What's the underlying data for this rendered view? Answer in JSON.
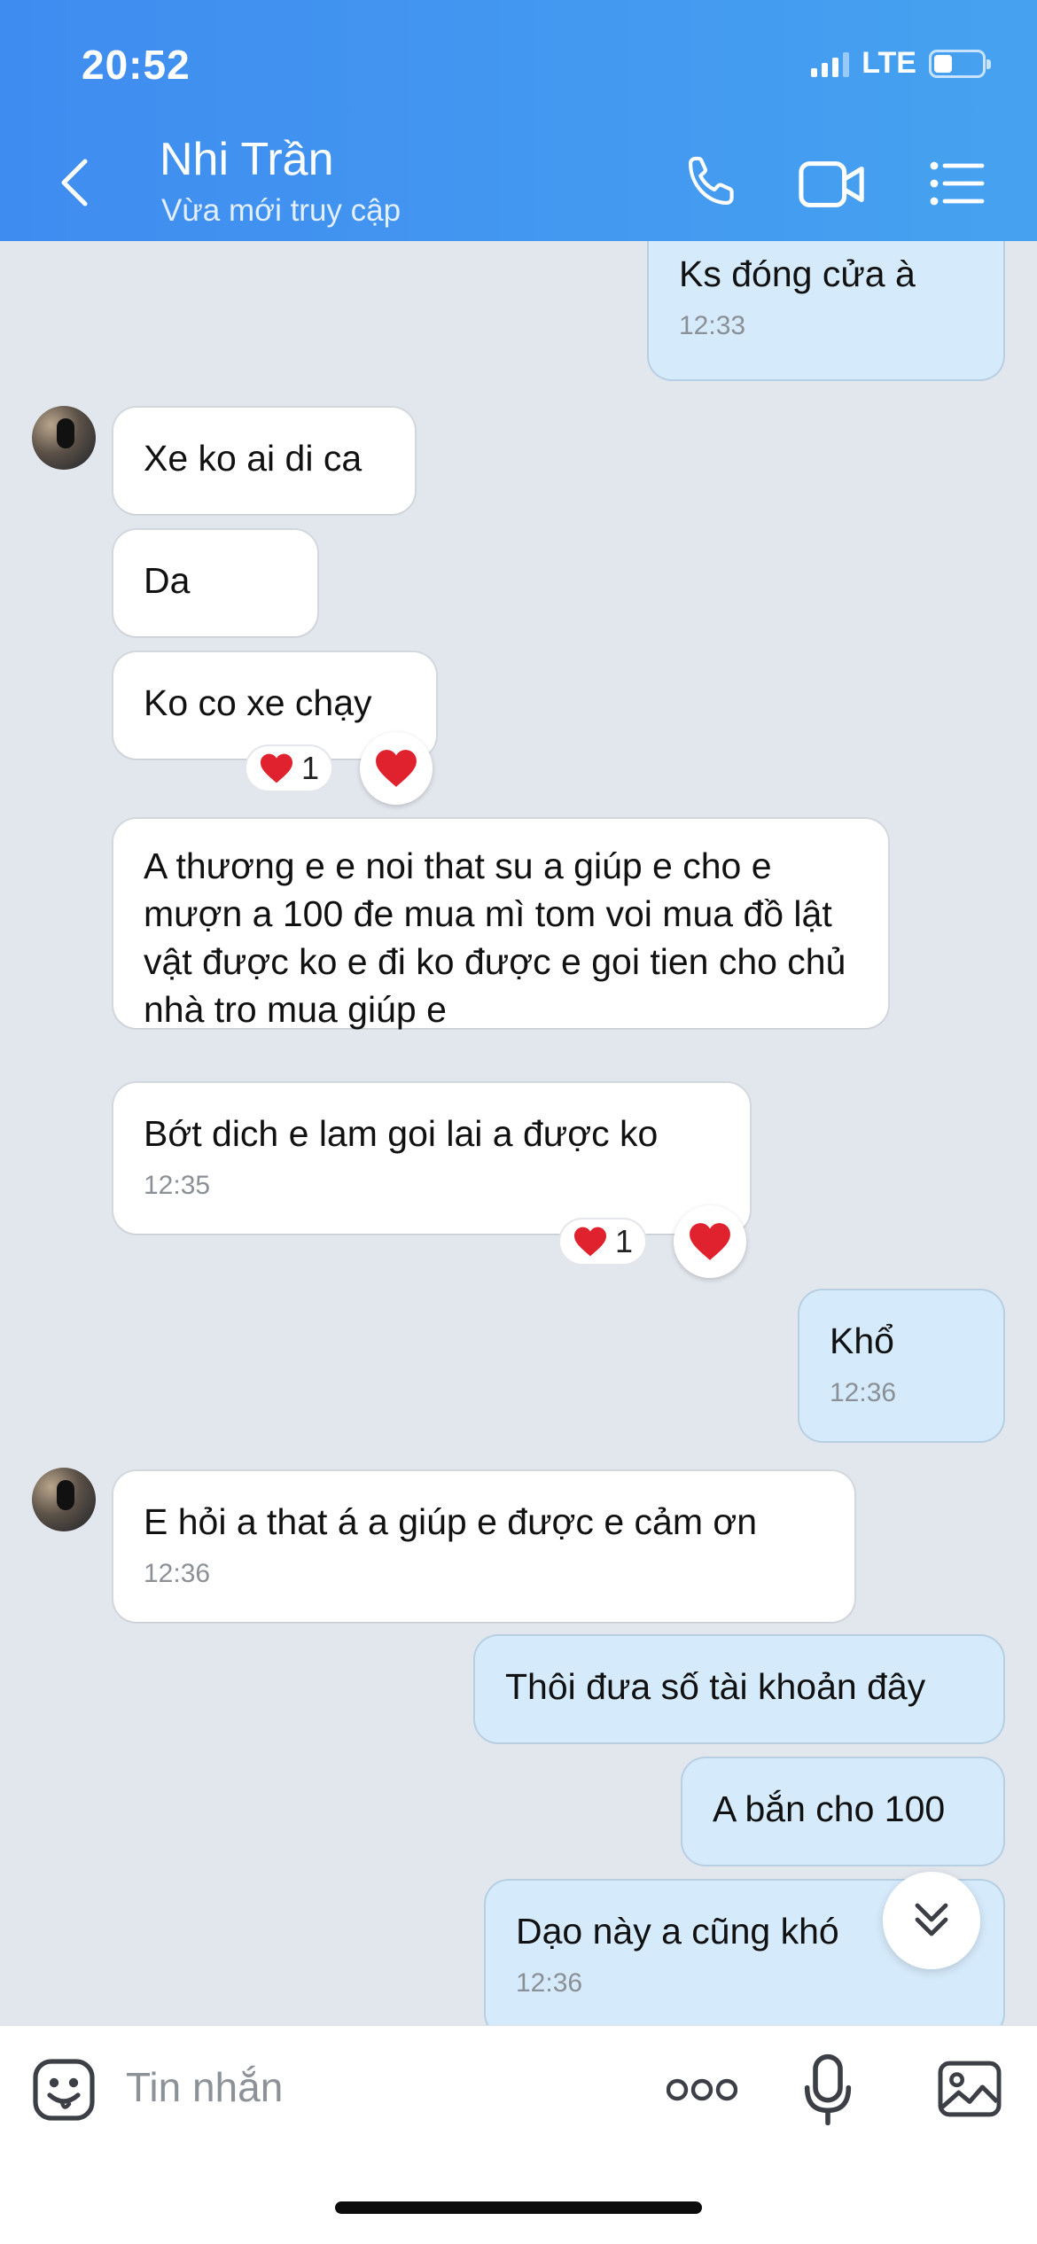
{
  "status_bar": {
    "time": "20:52",
    "network": "LTE"
  },
  "header": {
    "contact_name": "Nhi Trần",
    "contact_status": "Vừa mới truy cập",
    "icons": [
      "back-arrow-icon",
      "phone-icon",
      "video-call-icon",
      "menu-list-icon"
    ]
  },
  "messages": [
    {
      "dir": "out",
      "text": "Ks đóng cửa à",
      "time": "12:33"
    },
    {
      "dir": "in",
      "text": "Xe ko ai di ca"
    },
    {
      "dir": "in",
      "text": "Da"
    },
    {
      "dir": "in",
      "text": "Ko co xe chạy",
      "reaction_count": "1"
    },
    {
      "dir": "in",
      "text": "A thương e e noi that su a giúp e cho e mượn a 100 đe mua mì tom voi mua đồ lật vật được ko e đi ko được e goi tien cho chủ nhà tro mua giúp e"
    },
    {
      "dir": "in",
      "text": "Bớt dich e lam goi lai a được ko",
      "time": "12:35",
      "reaction_count": "1"
    },
    {
      "dir": "out",
      "text": "Khổ",
      "time": "12:36"
    },
    {
      "dir": "in",
      "text": "E hỏi a that á a giúp e được e cảm ơn",
      "time": "12:36"
    },
    {
      "dir": "out",
      "text": "Thôi đưa số tài khoản đây"
    },
    {
      "dir": "out",
      "text": "A bắn cho 100"
    },
    {
      "dir": "out",
      "text": "Dạo này a cũng khó",
      "time": "12:36"
    }
  ],
  "input": {
    "placeholder": "Tin nhắn"
  },
  "colors": {
    "header": "#3f8cf0",
    "outgoing_bubble": "#d5eafb",
    "incoming_bubble": "#ffffff",
    "chat_bg": "#e2e6ed",
    "heart": "#e0222e"
  }
}
